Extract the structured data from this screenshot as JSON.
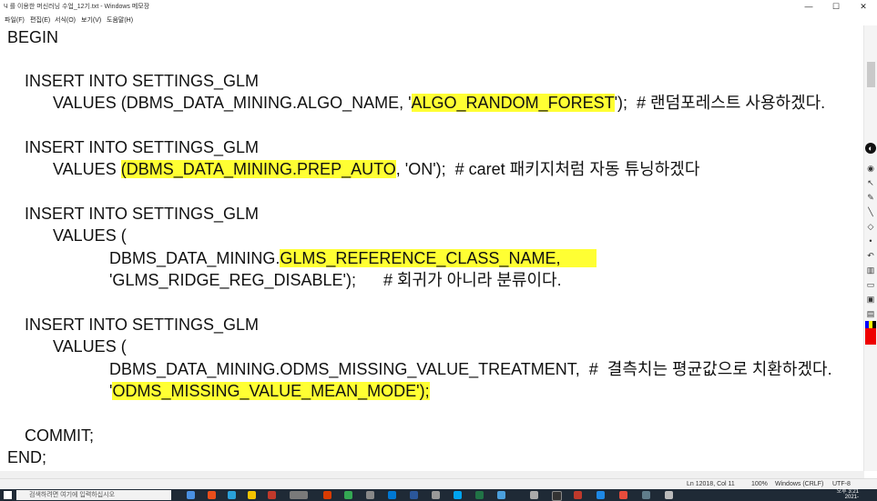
{
  "window": {
    "title": "Ч 를 이용한 머신러닝 수업_12기.txt - Windows 메모장",
    "minimize": "—",
    "maximize": "☐",
    "close": "✕"
  },
  "menu": {
    "items": [
      {
        "label": "파일(F)"
      },
      {
        "label": "편집(E)"
      },
      {
        "label": "서식(O)"
      },
      {
        "label": "보기(V)"
      },
      {
        "label": "도움말(H)"
      }
    ]
  },
  "editor": {
    "lines": {
      "l1": "BEGIN",
      "l3": "INSERT INTO SETTINGS_GLM",
      "l4a": "VALUES (DBMS_DATA_MINING.ALGO_NAME, '",
      "l4b": "ALGO_RANDOM_FOREST",
      "l4c": "');  # 랜덤포레스트 사용하겠다.",
      "l6": "INSERT INTO SETTINGS_GLM",
      "l7a": "VALUES ",
      "l7b": "(DBMS_DATA_MINING.PREP_AUTO",
      "l7c": ", 'ON');  # caret 패키지처럼 자동 튜닝하겠다",
      "l9": "INSERT INTO SETTINGS_GLM",
      "l10": "VALUES (",
      "l11a": "DBMS_DATA_MINING.",
      "l11b": "GLMS_REFERENCE_CLASS_NAME,",
      "l12": "'GLMS_RIDGE_REG_DISABLE');      # 회귀가 아니라 분류이다.",
      "l14": "INSERT INTO SETTINGS_GLM",
      "l15": "VALUES (",
      "l16": "DBMS_DATA_MINING.ODMS_MISSING_VALUE_TREATMENT,  #  결측치는 평균값으로 치환하겠다.",
      "l17a": "'",
      "l17b": "ODMS_MISSING_VALUE_MEAN_MODE');",
      "l19": "COMMIT;",
      "l20": "END;"
    },
    "highlight_color": "#ffff33"
  },
  "status": {
    "position": "Ln 12018, Col 11",
    "zoom": "100%",
    "eol": "Windows (CRLF)",
    "encoding": "UTF-8"
  },
  "taskbar": {
    "search_placeholder": "검색하려면 여기에 입력하십시오",
    "time": "오후 3:21",
    "date": "2021-"
  }
}
